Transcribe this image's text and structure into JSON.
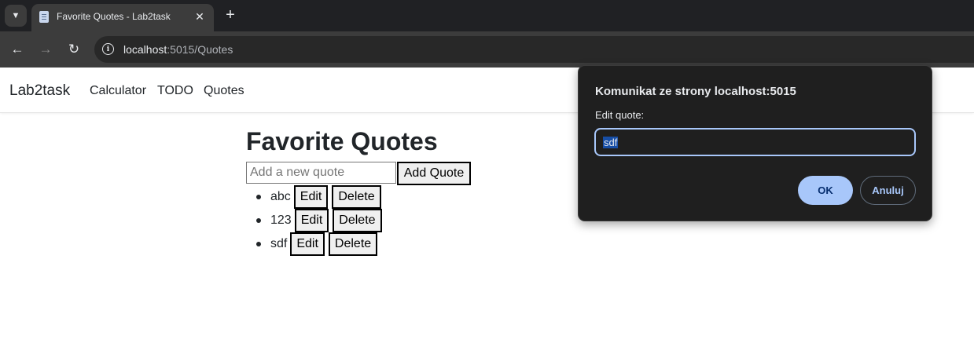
{
  "browser": {
    "tab": {
      "title": "Favorite Quotes - Lab2task",
      "favicon": "page-icon"
    },
    "address": {
      "host": "localhost",
      "path": ":5015/Quotes"
    }
  },
  "navbar": {
    "brand": "Lab2task",
    "links": [
      "Calculator",
      "TODO",
      "Quotes"
    ]
  },
  "main": {
    "title": "Favorite Quotes",
    "input_placeholder": "Add a new quote",
    "add_button": "Add Quote",
    "quotes": [
      {
        "text": "abc",
        "edit": "Edit",
        "delete": "Delete"
      },
      {
        "text": "123",
        "edit": "Edit",
        "delete": "Delete"
      },
      {
        "text": "sdf",
        "edit": "Edit",
        "delete": "Delete"
      }
    ]
  },
  "dialog": {
    "title": "Komunikat ze strony localhost:5015",
    "message": "Edit quote:",
    "value": "sdf",
    "ok": "OK",
    "cancel": "Anuluj"
  },
  "colors": {
    "dialog_bg": "#1f1f1f",
    "accent": "#a8c7fa",
    "chrome_bg": "#202124"
  }
}
